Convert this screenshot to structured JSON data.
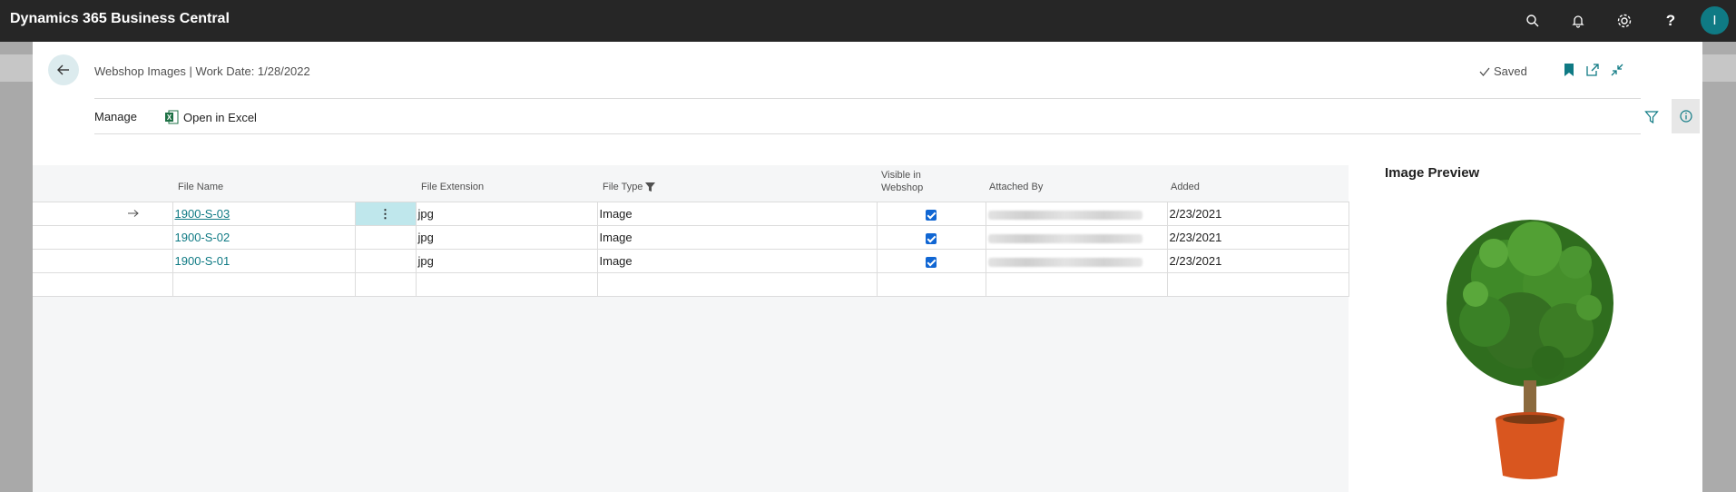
{
  "app": {
    "title": "Dynamics 365 Business Central",
    "user_initial": "I"
  },
  "topbar_icons": [
    "search-icon",
    "bell-icon",
    "gear-icon",
    "help-icon"
  ],
  "page": {
    "title": "Webshop Images | Work Date: 1/28/2022",
    "saved_label": "Saved"
  },
  "actions": {
    "manage_label": "Manage",
    "excel_label": "Open in Excel"
  },
  "table": {
    "columns": {
      "file_name": "File Name",
      "file_extension": "File Extension",
      "file_type": "File Type",
      "visible_line1": "Visible in",
      "visible_line2": "Webshop",
      "attached_by": "Attached By",
      "added": "Added"
    },
    "rows": [
      {
        "file_name": "1900-S-03",
        "extension": "jpg",
        "type": "Image",
        "visible": true,
        "added": "2/23/2021",
        "selected": true
      },
      {
        "file_name": "1900-S-02",
        "extension": "jpg",
        "type": "Image",
        "visible": true,
        "added": "2/23/2021",
        "selected": false
      },
      {
        "file_name": "1900-S-01",
        "extension": "jpg",
        "type": "Image",
        "visible": true,
        "added": "2/23/2021",
        "selected": false
      }
    ]
  },
  "preview": {
    "title": "Image Preview"
  },
  "colors": {
    "accent": "#0f7a84",
    "topbar": "#262626",
    "checkbox": "#1066d3",
    "excel_green": "#1e7145"
  }
}
